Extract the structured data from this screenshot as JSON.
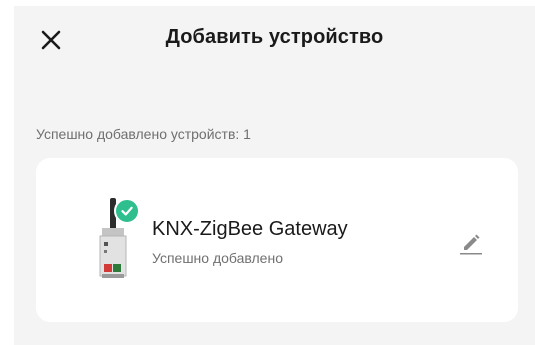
{
  "header": {
    "title": "Добавить устройство",
    "close_icon": "close-icon"
  },
  "summary": {
    "text": "Успешно добавлено устройств: 1"
  },
  "devices": [
    {
      "name": "KNX-ZigBee Gateway",
      "status": "Успешно добавлено",
      "badge_icon": "check-icon",
      "edit_icon": "pencil-icon"
    }
  ],
  "colors": {
    "success": "#2fbf8f",
    "background": "#f4f4f4",
    "card": "#ffffff"
  }
}
